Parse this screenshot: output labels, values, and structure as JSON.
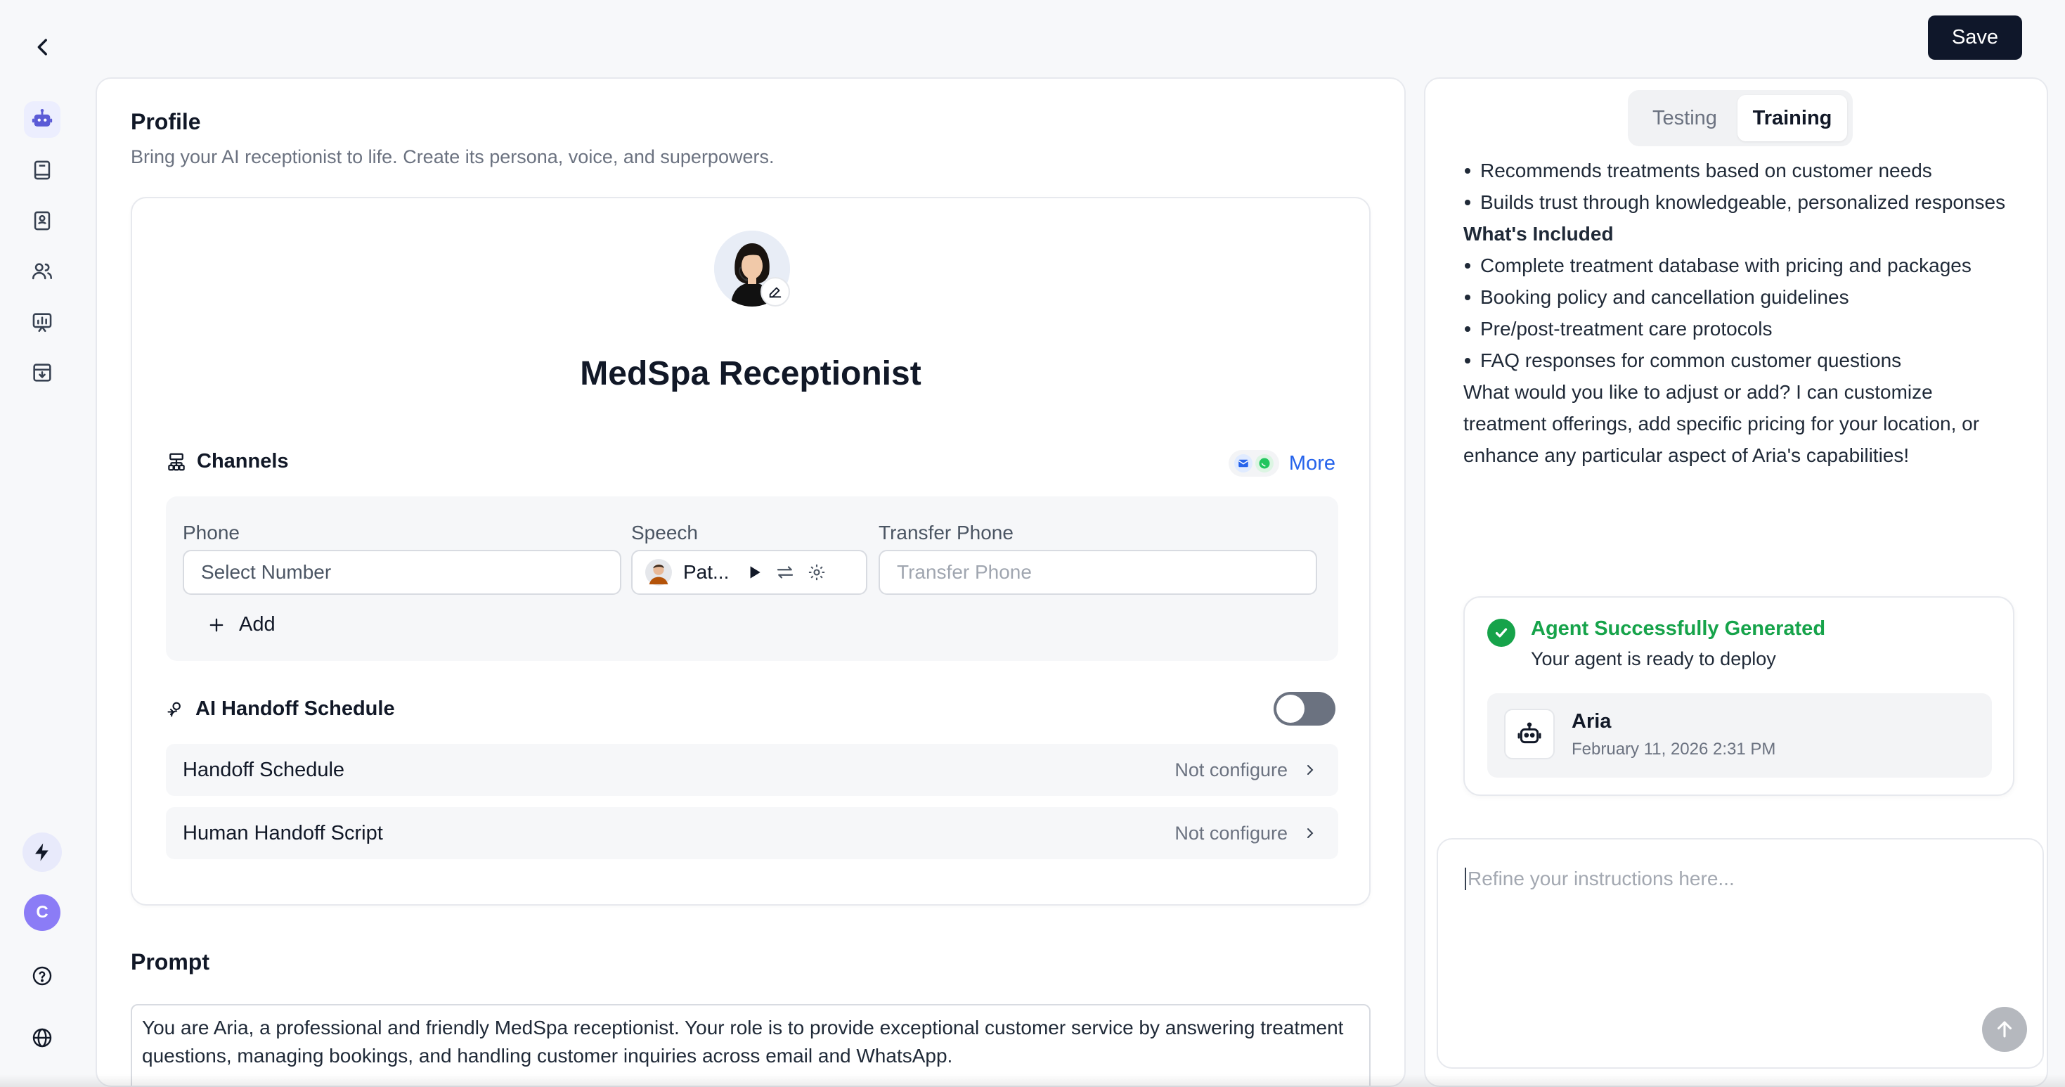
{
  "header": {
    "save_label": "Save"
  },
  "sidebar": {
    "items": [
      {
        "icon": "robot-icon",
        "active": true
      },
      {
        "icon": "book-icon"
      },
      {
        "icon": "contact-book-icon"
      },
      {
        "icon": "users-icon"
      },
      {
        "icon": "chart-icon"
      },
      {
        "icon": "inbox-download-icon"
      }
    ],
    "bottom": {
      "avatar_initial": "C"
    }
  },
  "profile": {
    "title": "Profile",
    "subtitle": "Bring your AI receptionist to life. Create its persona, voice, and superpowers.",
    "agent_name": "MedSpa Receptionist"
  },
  "channels": {
    "title": "Channels",
    "more_label": "More",
    "phone_label": "Phone",
    "speech_label": "Speech",
    "transfer_label": "Transfer Phone",
    "phone_value": "Select Number",
    "speech_voice": "Pat...",
    "transfer_placeholder": "Transfer Phone",
    "add_label": "Add"
  },
  "handoff": {
    "title": "AI Handoff Schedule",
    "enabled": false,
    "rows": [
      {
        "label": "Handoff Schedule",
        "status": "Not configure"
      },
      {
        "label": "Human Handoff Script",
        "status": "Not configure"
      }
    ]
  },
  "prompt": {
    "title": "Prompt",
    "text": "You are Aria, a professional and friendly MedSpa receptionist. Your role is to provide exceptional customer service by answering treatment questions, managing bookings, and handling customer inquiries across email and WhatsApp."
  },
  "right_panel": {
    "tabs": [
      "Testing",
      "Training"
    ],
    "active_tab": "Training",
    "chat": {
      "bullets_top": [
        "Recommends treatments based on customer needs",
        "Builds trust through knowledgeable, personalized responses"
      ],
      "included_heading": "What's Included",
      "bullets_included": [
        "Complete treatment database with pricing and packages",
        "Booking policy and cancellation guidelines",
        "Pre/post-treatment care protocols",
        "FAQ responses for common customer questions"
      ],
      "closing": "What would you like to adjust or add? I can customize treatment offerings, add specific pricing for your location, or enhance any particular aspect of Aria's capabilities!"
    },
    "success": {
      "title": "Agent Successfully Generated",
      "subtitle": "Your agent is ready to deploy",
      "agent_name": "Aria",
      "timestamp": "February 11, 2026 2:31 PM"
    },
    "refine_placeholder": "Refine your instructions here..."
  },
  "colors": {
    "accent": "#2563eb",
    "success": "#16a34a",
    "dark_button": "#0f172a",
    "rail_active": "#5b5bd6"
  }
}
